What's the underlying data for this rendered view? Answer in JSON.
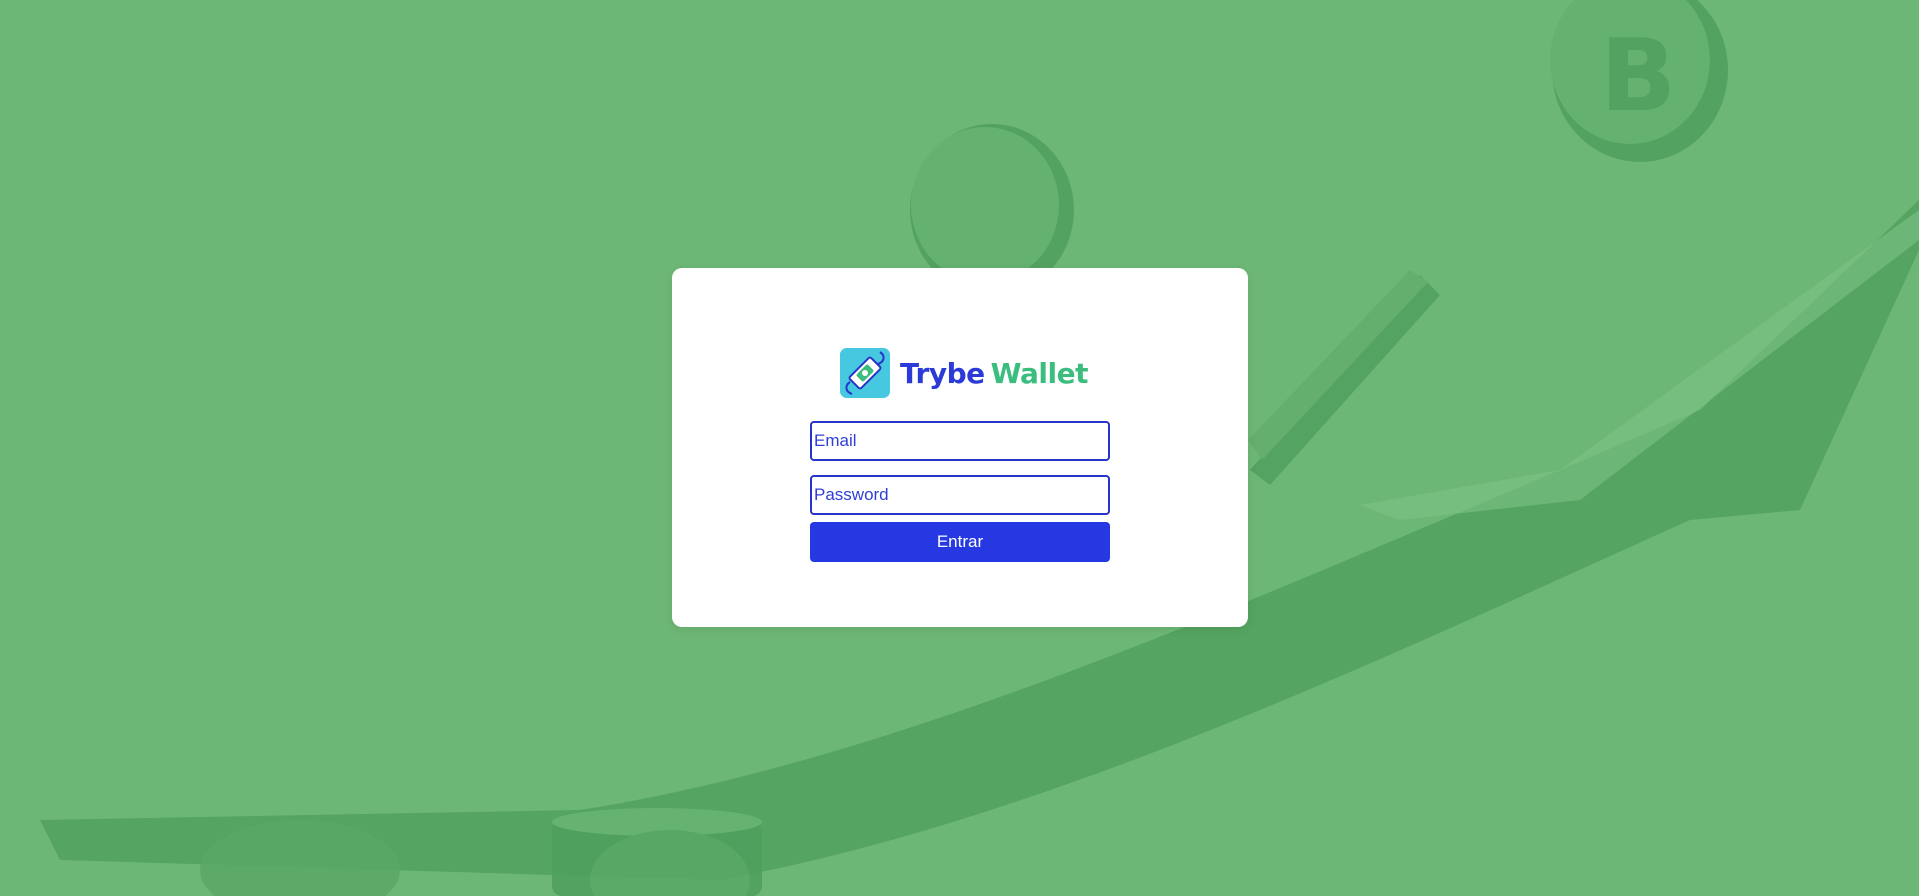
{
  "brand": {
    "word1": "Trybe",
    "word2": "Wallet",
    "icon": "wallet-money-icon",
    "colors": {
      "word1": "#2c3ad8",
      "word2": "#3bbd7e",
      "icon_bg": "#46c9e0"
    }
  },
  "form": {
    "email_placeholder": "Email",
    "email_value": "",
    "password_placeholder": "Password",
    "password_value": "",
    "submit_label": "Entrar"
  },
  "theme": {
    "background": "#6db776",
    "accent": "#2638e2",
    "card": "#ffffff"
  }
}
